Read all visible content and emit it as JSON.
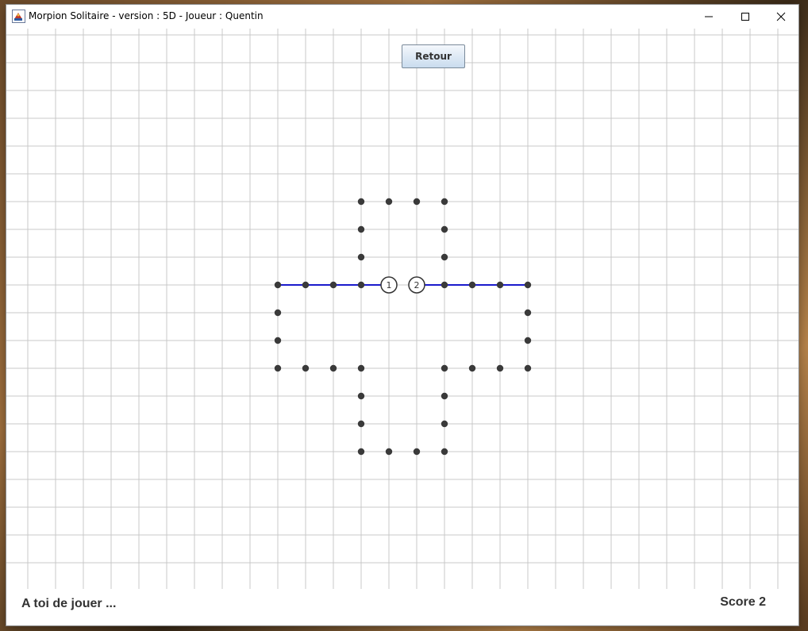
{
  "window": {
    "title": "Morpion Solitaire - version : 5D - Joueur : Quentin"
  },
  "toolbar": {
    "retour_label": "Retour"
  },
  "board": {
    "cols": 28,
    "rows": 20,
    "grid_color": "#c8c8c8",
    "point_color": "#3a3a3a",
    "line_color": "#1a1acc",
    "points": [
      [
        13,
        6
      ],
      [
        14,
        6
      ],
      [
        15,
        6
      ],
      [
        16,
        6
      ],
      [
        13,
        7
      ],
      [
        16,
        7
      ],
      [
        13,
        8
      ],
      [
        16,
        8
      ],
      [
        10,
        9
      ],
      [
        11,
        9
      ],
      [
        12,
        9
      ],
      [
        13,
        9
      ],
      [
        16,
        9
      ],
      [
        17,
        9
      ],
      [
        18,
        9
      ],
      [
        19,
        9
      ],
      [
        10,
        10
      ],
      [
        19,
        10
      ],
      [
        10,
        11
      ],
      [
        19,
        11
      ],
      [
        10,
        12
      ],
      [
        11,
        12
      ],
      [
        12,
        12
      ],
      [
        13,
        12
      ],
      [
        16,
        12
      ],
      [
        17,
        12
      ],
      [
        18,
        12
      ],
      [
        19,
        12
      ],
      [
        13,
        13
      ],
      [
        16,
        13
      ],
      [
        13,
        14
      ],
      [
        16,
        14
      ],
      [
        13,
        15
      ],
      [
        14,
        15
      ],
      [
        15,
        15
      ],
      [
        16,
        15
      ]
    ],
    "moves": [
      {
        "number": "1",
        "at": [
          14,
          9
        ],
        "line": [
          [
            10,
            9
          ],
          [
            14,
            9
          ]
        ]
      },
      {
        "number": "2",
        "at": [
          15,
          9
        ],
        "line": [
          [
            15,
            9
          ],
          [
            19,
            9
          ]
        ]
      }
    ]
  },
  "status": {
    "message": "A toi de jouer ...",
    "score_text": "Score 2"
  }
}
